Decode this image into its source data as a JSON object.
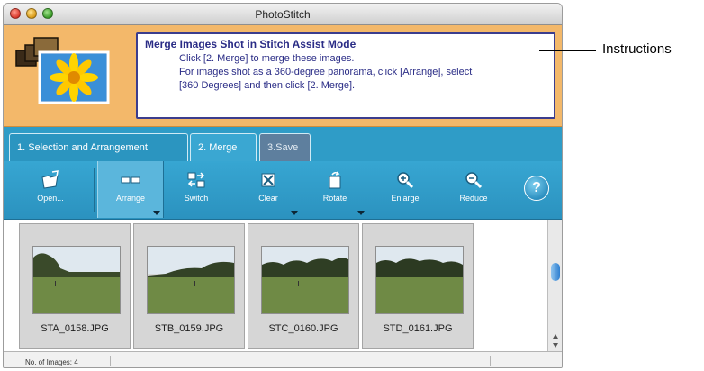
{
  "window": {
    "title": "PhotoStitch"
  },
  "instructions": {
    "title": "Merge Images Shot in Stitch Assist Mode",
    "line1": "Click [2.  Merge] to merge these images.",
    "line2": "For images shot as a 360-degree panorama, click [Arrange], select",
    "line3": "[360 Degrees] and then click [2. Merge]."
  },
  "tabs": [
    {
      "label": "1. Selection and Arrangement",
      "active": true
    },
    {
      "label": "2. Merge",
      "active": false
    },
    {
      "label": "3.Save",
      "active": false
    }
  ],
  "toolbar": {
    "open": {
      "label": "Open...",
      "icon": "open-folder-icon"
    },
    "arrange": {
      "label": "Arrange",
      "icon": "arrange-icon"
    },
    "switch": {
      "label": "Switch",
      "icon": "switch-icon"
    },
    "clear": {
      "label": "Clear",
      "icon": "clear-icon"
    },
    "rotate": {
      "label": "Rotate",
      "icon": "rotate-icon"
    },
    "enlarge": {
      "label": "Enlarge",
      "icon": "zoom-in-icon"
    },
    "reduce": {
      "label": "Reduce",
      "icon": "zoom-out-icon"
    },
    "help": {
      "label": "?"
    }
  },
  "images": [
    {
      "filename": "STA_0158.JPG"
    },
    {
      "filename": "STB_0159.JPG"
    },
    {
      "filename": "STC_0160.JPG"
    },
    {
      "filename": "STD_0161.JPG"
    }
  ],
  "status": {
    "image_count": "No. of Images: 4"
  },
  "callout": {
    "label": "Instructions"
  },
  "colors": {
    "header_bg": "#f3b86a",
    "toolbar_bg": "#2f9cc7",
    "instruction_text": "#2a2c86"
  }
}
